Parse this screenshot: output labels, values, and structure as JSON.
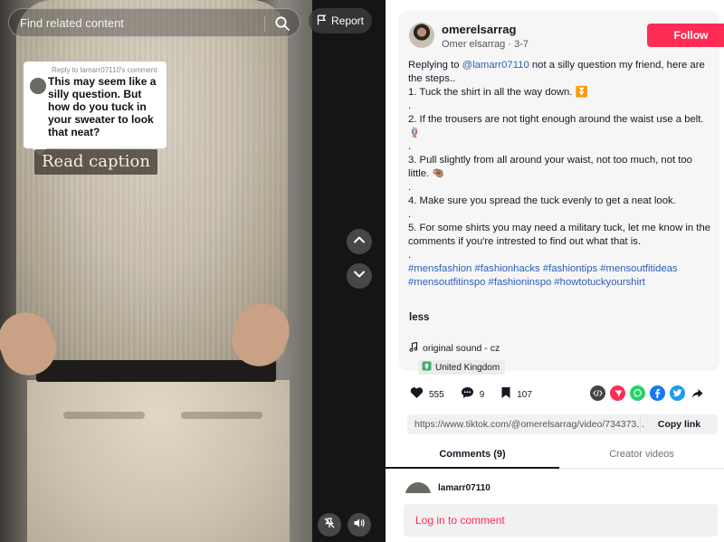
{
  "search": {
    "placeholder": "Find related content"
  },
  "report": {
    "label": "Report"
  },
  "overlay": {
    "reply_label": "Reply to lamarr07110's comment",
    "comment_text": "This may seem like a silly question. But how do you tuck in your sweater to look that neat?",
    "read_caption": "Read caption"
  },
  "author": {
    "username": "omerelsarrag",
    "display_name": "Omer elsarrag",
    "date": "3-7",
    "follow_label": "Follow"
  },
  "caption": {
    "replying_prefix": "Replying to",
    "mention": "@lamarr07110",
    "intro": "not a silly question my friend, here are the steps..",
    "lines": [
      "1. Tuck the shirt in all the way down. ⏬",
      ".",
      "2. If the trousers are not tight enough around the waist use a belt.🪢",
      ".",
      "3. Pull slightly from all around your waist, not too much, not too little. 🤏🏽",
      ".",
      "4. Make sure you spread the tuck evenly to get a neat look.",
      ".",
      "5. For some shirts you may need a military tuck, let me know in the comments if you're intrested to find out what that is.",
      "."
    ],
    "hashtags": "#mensfashion #fashionhacks #fashiontips #mensoutfitideas #mensoutfitinspo #fashioninspo #howtotuckyourshirt",
    "less_label": "less"
  },
  "sound": {
    "label": "original sound - cz"
  },
  "location": {
    "label": "United Kingdom"
  },
  "stats": {
    "likes": "555",
    "comments": "9",
    "saves": "107"
  },
  "share_icons": [
    "embed-icon",
    "send-icon",
    "whatsapp-icon",
    "facebook-icon",
    "twitter-icon",
    "share-arrow-icon"
  ],
  "link": {
    "url": "https://www.tiktok.com/@omerelsarrag/video/734373...",
    "copy_label": "Copy link"
  },
  "tabs": {
    "comments": "Comments (9)",
    "creator_videos": "Creator videos"
  },
  "comment_preview": {
    "name": "lamarr07110"
  },
  "login": {
    "label": "Log in to comment"
  },
  "colors": {
    "accent": "#fe2c55",
    "link": "#2b5db9",
    "text": "#161823"
  }
}
